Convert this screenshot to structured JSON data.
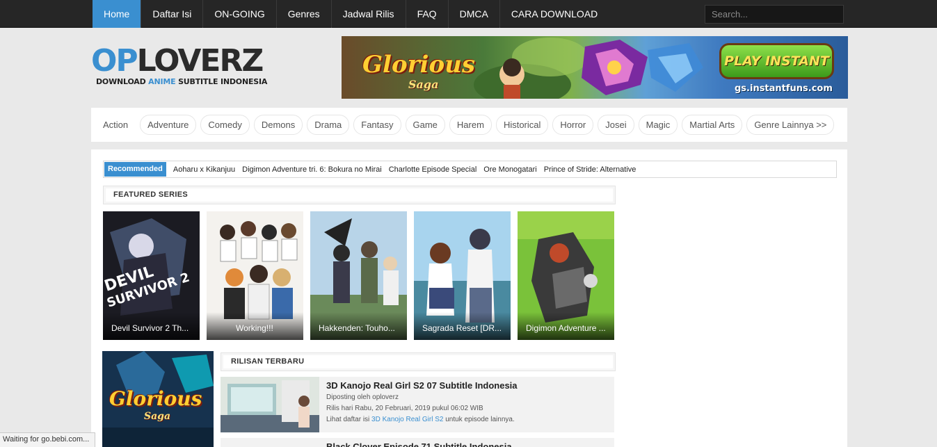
{
  "nav": {
    "items": [
      "Home",
      "Daftar Isi",
      "ON-GOING",
      "Genres",
      "Jadwal Rilis",
      "FAQ",
      "DMCA",
      "CARA DOWNLOAD"
    ],
    "active": "Home",
    "search_placeholder": "Search..."
  },
  "logo": {
    "op": "OP",
    "rest": "LOVERZ",
    "tag_pre": "DOWNLOAD ",
    "tag_hl": "ANIME",
    "tag_post": " SUBTITLE INDONESIA"
  },
  "banner": {
    "title": "Glorious",
    "subtitle": "Saga",
    "play": "PLAY INSTANT",
    "url": "gs.instantfuns.com"
  },
  "genres": [
    "Action",
    "Adventure",
    "Comedy",
    "Demons",
    "Drama",
    "Fantasy",
    "Game",
    "Harem",
    "Historical",
    "Horror",
    "Josei",
    "Magic",
    "Martial Arts",
    "Genre Lainnya >>"
  ],
  "recommended": {
    "label": "Recommended",
    "items": [
      "Aoharu x Kikanjuu",
      "Digimon Adventure tri. 6: Bokura no Mirai",
      "Charlotte Episode Special",
      "Ore Monogatari",
      "Prince of Stride: Alternative"
    ]
  },
  "featured": {
    "heading": "FEATURED SERIES",
    "items": [
      "Devil Survivor 2 Th...",
      "Working!!!",
      "Hakkenden: Touho...",
      "Sagrada Reset [DR...",
      "Digimon Adventure ..."
    ]
  },
  "latest": {
    "heading": "RILISAN TERBARU",
    "post1": {
      "title": "3D Kanojo Real Girl S2 07 Subtitle Indonesia",
      "author": "Diposting oleh oploverz",
      "date": "Rilis hari Rabu, 20 Februari, 2019 pukul 06:02 WIB",
      "more_pre": "Lihat daftar isi ",
      "more_link": "3D Kanojo Real Girl S2",
      "more_post": " untuk episode lainnya."
    },
    "post2_title": "Black Clover Episode 71 Subtitle Indonesia"
  },
  "side_ad": {
    "title": "Glorious",
    "subtitle": "Saga"
  },
  "status": "Waiting for go.bebi.com...",
  "colors": {
    "accent": "#3a8fd0",
    "nav_bg": "#262626"
  }
}
